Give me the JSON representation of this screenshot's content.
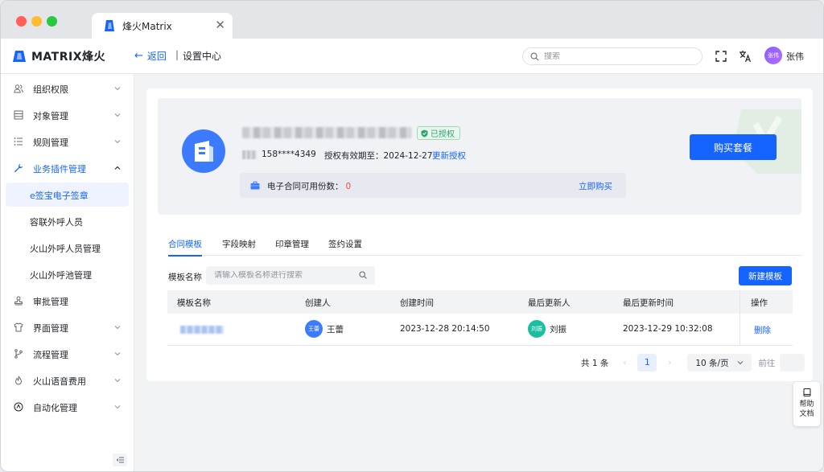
{
  "browser": {
    "tab_title": "烽火Matrix",
    "tab_close": "✕"
  },
  "header": {
    "brand": "MATRIX烽火",
    "back_label": "返回",
    "separator": "|",
    "breadcrumb": "设置中心",
    "search_placeholder": "搜索",
    "user": {
      "avatar_text": "张伟",
      "name": "张伟"
    }
  },
  "sidebar": {
    "items": [
      {
        "label": "组织权限",
        "icon": "users-icon",
        "expandable": true
      },
      {
        "label": "对象管理",
        "icon": "table-icon",
        "expandable": true
      },
      {
        "label": "规则管理",
        "icon": "list-icon",
        "expandable": true
      },
      {
        "label": "业务插件管理",
        "icon": "wrench-icon",
        "expandable": true,
        "open": true
      },
      {
        "label": "e签宝电子签章",
        "sub": true,
        "active": true
      },
      {
        "label": "容联外呼人员",
        "sub": true
      },
      {
        "label": "火山外呼人员管理",
        "sub": true
      },
      {
        "label": "火山外呼池管理",
        "sub": true
      },
      {
        "label": "审批管理",
        "icon": "stamp-icon",
        "expandable": false
      },
      {
        "label": "界面管理",
        "icon": "shirt-icon",
        "expandable": true
      },
      {
        "label": "流程管理",
        "icon": "branch-icon",
        "expandable": true
      },
      {
        "label": "火山语音费用",
        "icon": "flame-icon",
        "expandable": true
      },
      {
        "label": "自动化管理",
        "icon": "robot-icon",
        "expandable": true
      }
    ]
  },
  "account": {
    "auth_badge": "已授权",
    "phone": "158****4349",
    "valid_until_label": "授权有效期至：2024-12-27",
    "renew_link": "更新授权",
    "quota_label": "电子合同可用份数：",
    "quota_value": "0",
    "quota_buy": "立即购买",
    "buy_package": "购买套餐"
  },
  "tabs": [
    {
      "label": "合同模板",
      "active": true
    },
    {
      "label": "字段映射"
    },
    {
      "label": "印章管理"
    },
    {
      "label": "签约设置"
    }
  ],
  "filter": {
    "label": "模板名称",
    "placeholder": "请输入模板名称进行搜索",
    "new_button": "新建模板"
  },
  "table": {
    "columns": [
      "模板名称",
      "创建人",
      "创建时间",
      "最后更新人",
      "最后更新时间",
      "操作"
    ],
    "rows": [
      {
        "creator": {
          "avatar": "王蕾",
          "name": "王蕾",
          "color": "#3c7bff"
        },
        "created_at": "2023-12-28 20:14:50",
        "updater": {
          "avatar": "刘振",
          "name": "刘振",
          "color": "#1bbfa0"
        },
        "updated_at": "2023-12-29 10:32:08",
        "action": "删除"
      }
    ]
  },
  "pagination": {
    "total": "共 1 条",
    "prev": "‹",
    "page": "1",
    "next": "›",
    "page_size": "10 条/页",
    "goto": "前往"
  },
  "help": {
    "label": "帮助文档"
  },
  "colors": {
    "primary": "#1664ff",
    "success": "#2ea36b",
    "danger": "#f54a45"
  }
}
